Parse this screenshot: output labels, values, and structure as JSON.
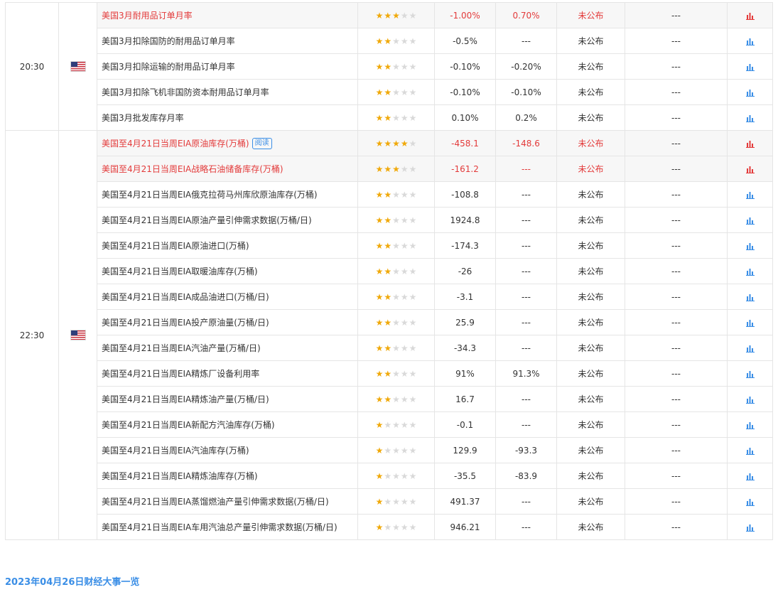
{
  "colors": {
    "red": "#e33b3b",
    "blue_icon": "#3a8ee6",
    "star_on": "#f0a90a",
    "star_off": "#d9d9d9"
  },
  "groups": [
    {
      "time": "20:30",
      "flag": "us-flag-icon",
      "rows": [
        {
          "event": "美国3月耐用品订单月率",
          "stars": 3,
          "actual": "-1.00%",
          "prev": "0.70%",
          "status": "未公布",
          "interp": "---",
          "red": true,
          "hl": true
        },
        {
          "event": "美国3月扣除国防的耐用品订单月率",
          "stars": 2,
          "actual": "-0.5%",
          "prev": "---",
          "status": "未公布",
          "interp": "---"
        },
        {
          "event": "美国3月扣除运输的耐用品订单月率",
          "stars": 2,
          "actual": "-0.10%",
          "prev": "-0.20%",
          "status": "未公布",
          "interp": "---"
        },
        {
          "event": "美国3月扣除飞机非国防资本耐用品订单月率",
          "stars": 2,
          "actual": "-0.10%",
          "prev": "-0.10%",
          "status": "未公布",
          "interp": "---"
        },
        {
          "event": "美国3月批发库存月率",
          "stars": 2,
          "actual": "0.10%",
          "prev": "0.2%",
          "status": "未公布",
          "interp": "---"
        }
      ]
    },
    {
      "time": "22:30",
      "flag": "us-flag-icon",
      "rows": [
        {
          "event": "美国至4月21日当周EIA原油库存(万桶)",
          "tag": "阅读",
          "stars": 4,
          "actual": "-458.1",
          "prev": "-148.6",
          "status": "未公布",
          "interp": "---",
          "red": true,
          "hl": true
        },
        {
          "event": "美国至4月21日当周EIA战略石油储备库存(万桶)",
          "stars": 3,
          "actual": "-161.2",
          "prev": "---",
          "status": "未公布",
          "interp": "---",
          "red": true,
          "hl": true
        },
        {
          "event": "美国至4月21日当周EIA俄克拉荷马州库欣原油库存(万桶)",
          "stars": 2,
          "actual": "-108.8",
          "prev": "---",
          "status": "未公布",
          "interp": "---"
        },
        {
          "event": "美国至4月21日当周EIA原油产量引伸需求数据(万桶/日)",
          "stars": 2,
          "actual": "1924.8",
          "prev": "---",
          "status": "未公布",
          "interp": "---"
        },
        {
          "event": "美国至4月21日当周EIA原油进口(万桶)",
          "stars": 2,
          "actual": "-174.3",
          "prev": "---",
          "status": "未公布",
          "interp": "---"
        },
        {
          "event": "美国至4月21日当周EIA取暖油库存(万桶)",
          "stars": 2,
          "actual": "-26",
          "prev": "---",
          "status": "未公布",
          "interp": "---"
        },
        {
          "event": "美国至4月21日当周EIA成品油进口(万桶/日)",
          "stars": 2,
          "actual": "-3.1",
          "prev": "---",
          "status": "未公布",
          "interp": "---"
        },
        {
          "event": "美国至4月21日当周EIA投产原油量(万桶/日)",
          "stars": 2,
          "actual": "25.9",
          "prev": "---",
          "status": "未公布",
          "interp": "---"
        },
        {
          "event": "美国至4月21日当周EIA汽油产量(万桶/日)",
          "stars": 2,
          "actual": "-34.3",
          "prev": "---",
          "status": "未公布",
          "interp": "---"
        },
        {
          "event": "美国至4月21日当周EIA精炼厂设备利用率",
          "stars": 2,
          "actual": "91%",
          "prev": "91.3%",
          "status": "未公布",
          "interp": "---"
        },
        {
          "event": "美国至4月21日当周EIA精炼油产量(万桶/日)",
          "stars": 2,
          "actual": "16.7",
          "prev": "---",
          "status": "未公布",
          "interp": "---"
        },
        {
          "event": "美国至4月21日当周EIA新配方汽油库存(万桶)",
          "stars": 1,
          "actual": "-0.1",
          "prev": "---",
          "status": "未公布",
          "interp": "---"
        },
        {
          "event": "美国至4月21日当周EIA汽油库存(万桶)",
          "stars": 1,
          "actual": "129.9",
          "prev": "-93.3",
          "status": "未公布",
          "interp": "---"
        },
        {
          "event": "美国至4月21日当周EIA精炼油库存(万桶)",
          "stars": 1,
          "actual": "-35.5",
          "prev": "-83.9",
          "status": "未公布",
          "interp": "---"
        },
        {
          "event": "美国至4月21日当周EIA蒸馏燃油产量引伸需求数据(万桶/日)",
          "stars": 1,
          "actual": "491.37",
          "prev": "---",
          "status": "未公布",
          "interp": "---"
        },
        {
          "event": "美国至4月21日当周EIA车用汽油总产量引伸需求数据(万桶/日)",
          "stars": 1,
          "actual": "946.21",
          "prev": "---",
          "status": "未公布",
          "interp": "---"
        }
      ]
    }
  ],
  "footer": {
    "link_text": "2023年04月26日财经大事一览"
  }
}
